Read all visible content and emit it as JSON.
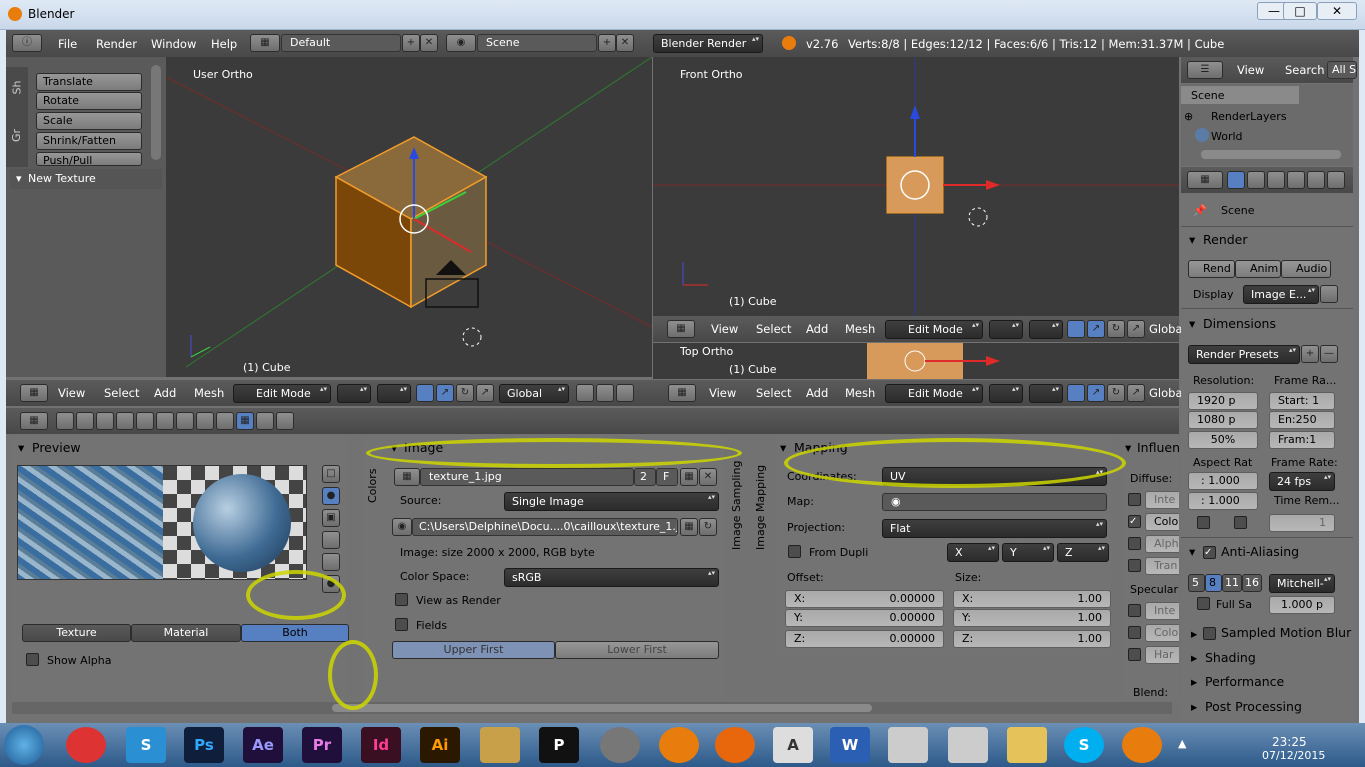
{
  "window": {
    "title": "Blender"
  },
  "topbar": {
    "menus": [
      "File",
      "Render",
      "Window",
      "Help"
    ],
    "layout": "Default",
    "scene": "Scene",
    "engine": "Blender Render",
    "version": "v2.76",
    "stats": "Verts:8/8 | Edges:12/12 | Faces:6/6 | Tris:12 | Mem:31.37M | Cube"
  },
  "toolshelf": {
    "tabs": [
      "Sh",
      "Gr"
    ],
    "buttons": [
      "Translate",
      "Rotate",
      "Scale",
      "Shrink/Fatten",
      "Push/Pull"
    ],
    "panel": "New Texture"
  },
  "viewport_left": {
    "label": "User Ortho",
    "object": "(1) Cube"
  },
  "viewport_front": {
    "label": "Front Ortho",
    "object": "(1) Cube"
  },
  "viewport_top": {
    "label": "Top Ortho",
    "object": "(1) Cube"
  },
  "view_header": {
    "items": [
      "View",
      "Select",
      "Add",
      "Mesh"
    ],
    "mode": "Edit Mode",
    "orientation": "Global",
    "orientation_short": "Globa"
  },
  "outliner": {
    "menus": [
      "View",
      "Search"
    ],
    "filter": "All Sc",
    "items": [
      "Scene",
      "RenderLayers",
      "World"
    ]
  },
  "props": {
    "scene": "Scene",
    "render_panel": "Render",
    "render_buttons": [
      "Rend",
      "Anim",
      "Audio"
    ],
    "display_label": "Display",
    "display_value": "Image E...",
    "dimensions": "Dimensions",
    "render_presets": "Render Presets",
    "resolution_label": "Resolution:",
    "res_x": "1920 p",
    "res_y": "1080 p",
    "res_pct": "50%",
    "frame_range_label": "Frame Ra...",
    "start": "Start: 1",
    "end": "En:250",
    "frame": "Fram:1",
    "aspect_label": "Aspect Rat",
    "aspect_x": ": 1.000",
    "aspect_y": ": 1.000",
    "frame_rate_label": "Frame Rate:",
    "fps": "24 fps",
    "time_rem": "Time Rem...",
    "time_val": "1",
    "aa": "Anti-Aliasing",
    "aa_samples": [
      "5",
      "8",
      "11",
      "16"
    ],
    "aa_filter": "Mitchell-",
    "full_sample": "Full Sa",
    "aa_size": "1.000 p",
    "motion_blur": "Sampled Motion Blur",
    "shading": "Shading",
    "performance": "Performance",
    "post": "Post Processing"
  },
  "texture": {
    "preview_title": "Preview",
    "preview_tabs": [
      "Texture",
      "Material",
      "Both"
    ],
    "show_alpha": "Show Alpha",
    "image_title": "Image",
    "side_tabs": [
      "Colors",
      "Image Sampling",
      "Image Mapping"
    ],
    "image_name": "texture_1.jpg",
    "users": "2",
    "fake": "F",
    "source_label": "Source:",
    "source": "Single Image",
    "path": "C:\\Users\\Delphine\\Docu....0\\cailloux\\texture_1.jpg",
    "info": "Image: size 2000 x 2000, RGB byte",
    "color_space_label": "Color Space:",
    "color_space": "sRGB",
    "view_as_render": "View as Render",
    "fields": "Fields",
    "upper_first": "Upper First",
    "lower_first": "Lower First",
    "mapping_title": "Mapping",
    "coordinates_label": "Coordinates:",
    "coordinates": "UV",
    "map_label": "Map:",
    "projection_label": "Projection:",
    "projection": "Flat",
    "from_dupli": "From Dupli",
    "axes": [
      "X",
      "Y",
      "Z"
    ],
    "offset_label": "Offset:",
    "size_label": "Size:",
    "offset": [
      {
        "k": "X:",
        "v": "0.00000"
      },
      {
        "k": "Y:",
        "v": "0.00000"
      },
      {
        "k": "Z:",
        "v": "0.00000"
      }
    ],
    "size": [
      {
        "k": "X:",
        "v": "1.00"
      },
      {
        "k": "Y:",
        "v": "1.00"
      },
      {
        "k": "Z:",
        "v": "1.00"
      }
    ],
    "influence_title": "Influen",
    "diffuse_label": "Diffuse:",
    "specular_label": "Specular:",
    "blend_label": "Blend:",
    "influence_items": [
      "Inte",
      "Colo",
      "Alph",
      "Tran"
    ],
    "spec_items": [
      "Inte",
      "Colo",
      "Har"
    ]
  },
  "taskbar": {
    "apps": [
      "Ps",
      "Ae",
      "Pr",
      "Id",
      "Ai",
      "P"
    ],
    "time": "23:25",
    "date": "07/12/2015"
  },
  "colors": {
    "accent": "#5680c2",
    "selected": "#f39c2a",
    "annotation": "#cdd600"
  }
}
